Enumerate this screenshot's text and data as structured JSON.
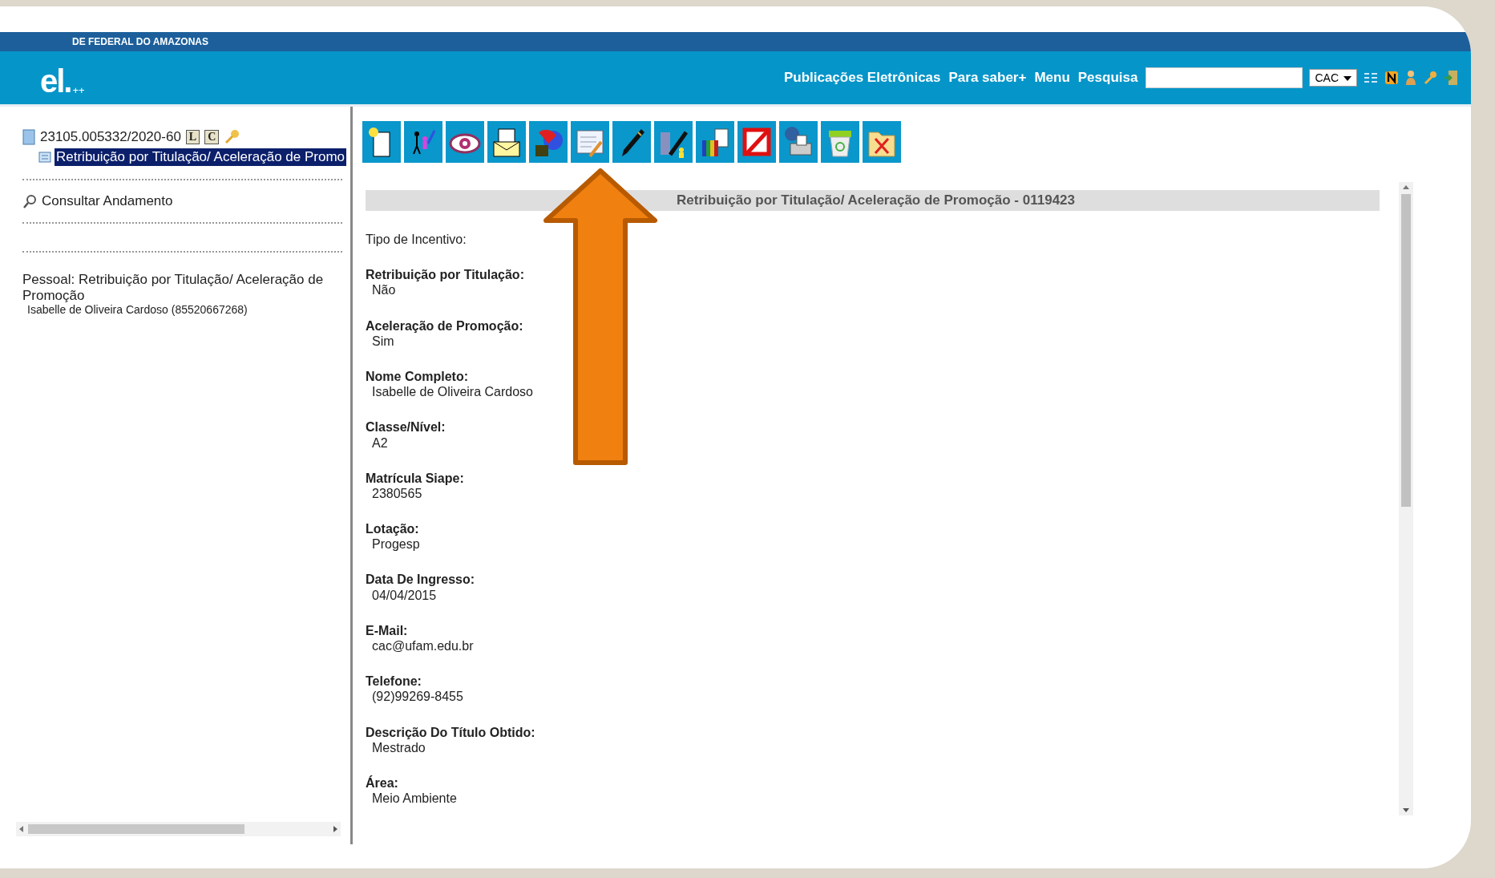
{
  "header": {
    "org": "DE FEDERAL DO AMAZONAS",
    "logo": "el.",
    "logo_suffix": "++",
    "links": [
      "Publicações Eletrônicas",
      "Para saber+",
      "Menu",
      "Pesquisa"
    ],
    "unit_select": "CAC"
  },
  "tree": {
    "process": {
      "number": "23105.005332/2020-60",
      "badges": [
        "L",
        "C"
      ],
      "children": [
        {
          "label": "Retribuição por Titulação/ Aceleração de Promo",
          "selected": true
        }
      ]
    },
    "action": "Consultar Andamento",
    "info_title": "Pessoal: Retribuição por Titulação/ Aceleração de Promoção",
    "info_person": "Isabelle de Oliveira Cardoso (85520667268)"
  },
  "document": {
    "title": "Retribuição por Titulação/ Aceleração de Promoção - 0119423",
    "fields": [
      {
        "kind": "plain",
        "label": "Tipo de Incentivo:"
      },
      {
        "kind": "field",
        "label": "Retribuição por Titulação:",
        "value": "Não"
      },
      {
        "kind": "field",
        "label": "Aceleração de Promoção:",
        "value": "Sim"
      },
      {
        "kind": "field",
        "label": "Nome Completo:",
        "value": "Isabelle de Oliveira Cardoso"
      },
      {
        "kind": "field",
        "label": "Classe/Nível:",
        "value": "A2"
      },
      {
        "kind": "field",
        "label": "Matrícula Siape:",
        "value": "2380565"
      },
      {
        "kind": "field",
        "label": "Lotação:",
        "value": "Progesp"
      },
      {
        "kind": "field",
        "label": "Data De Ingresso:",
        "value": "04/04/2015"
      },
      {
        "kind": "field",
        "label": "E-Mail:",
        "value": "cac@ufam.edu.br"
      },
      {
        "kind": "field",
        "label": "Telefone:",
        "value": "(92)99269-8455"
      },
      {
        "kind": "field",
        "label": "Descrição Do Título Obtido:",
        "value": "Mestrado"
      },
      {
        "kind": "field",
        "label": "Área:",
        "value": "Meio Ambiente"
      }
    ]
  }
}
